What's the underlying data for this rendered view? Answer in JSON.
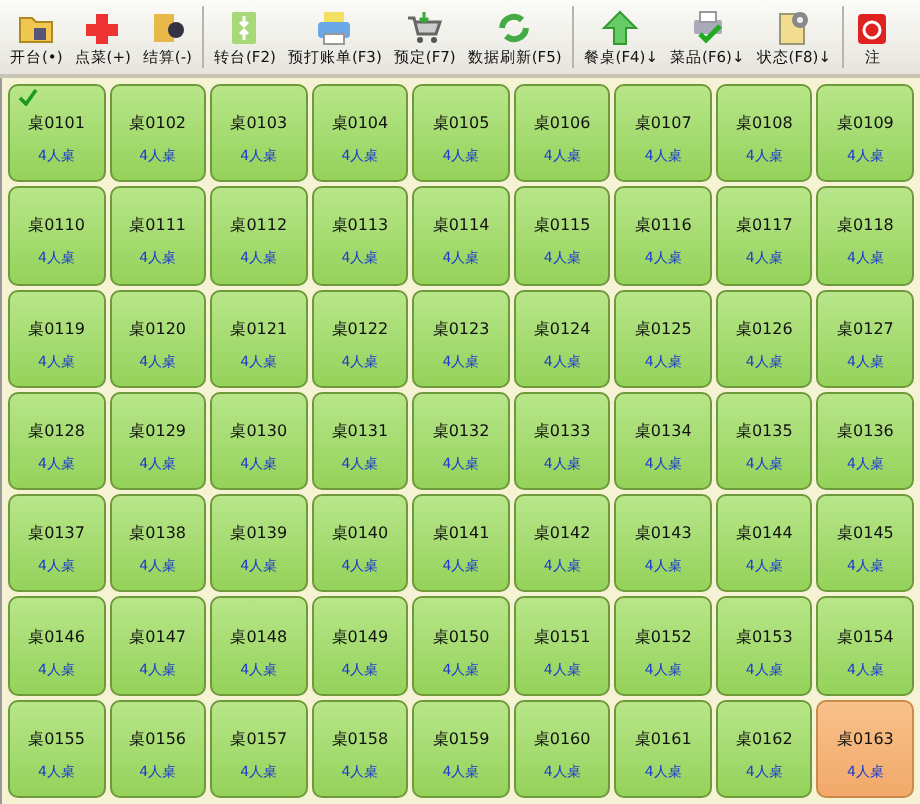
{
  "toolbar": [
    {
      "label": "开台(•)"
    },
    {
      "label": "点菜(+)"
    },
    {
      "label": "结算(-)"
    },
    {
      "label": "转台(F2)"
    },
    {
      "label": "预打账单(F3)"
    },
    {
      "label": "预定(F7)"
    },
    {
      "label": "数据刷新(F5)"
    },
    {
      "label": "餐桌(F4)↓"
    },
    {
      "label": "菜品(F6)↓"
    },
    {
      "label": "状态(F8)↓"
    },
    {
      "label": "注"
    }
  ],
  "tables": [
    {
      "name": "桌0101",
      "capacity": "4人桌",
      "checked": true,
      "highlighted": false
    },
    {
      "name": "桌0102",
      "capacity": "4人桌",
      "checked": false,
      "highlighted": false
    },
    {
      "name": "桌0103",
      "capacity": "4人桌",
      "checked": false,
      "highlighted": false
    },
    {
      "name": "桌0104",
      "capacity": "4人桌",
      "checked": false,
      "highlighted": false
    },
    {
      "name": "桌0105",
      "capacity": "4人桌",
      "checked": false,
      "highlighted": false
    },
    {
      "name": "桌0106",
      "capacity": "4人桌",
      "checked": false,
      "highlighted": false
    },
    {
      "name": "桌0107",
      "capacity": "4人桌",
      "checked": false,
      "highlighted": false
    },
    {
      "name": "桌0108",
      "capacity": "4人桌",
      "checked": false,
      "highlighted": false
    },
    {
      "name": "桌0109",
      "capacity": "4人桌",
      "checked": false,
      "highlighted": false
    },
    {
      "name": "桌0110",
      "capacity": "4人桌",
      "checked": false,
      "highlighted": false
    },
    {
      "name": "桌0111",
      "capacity": "4人桌",
      "checked": false,
      "highlighted": false
    },
    {
      "name": "桌0112",
      "capacity": "4人桌",
      "checked": false,
      "highlighted": false
    },
    {
      "name": "桌0113",
      "capacity": "4人桌",
      "checked": false,
      "highlighted": false
    },
    {
      "name": "桌0114",
      "capacity": "4人桌",
      "checked": false,
      "highlighted": false
    },
    {
      "name": "桌0115",
      "capacity": "4人桌",
      "checked": false,
      "highlighted": false
    },
    {
      "name": "桌0116",
      "capacity": "4人桌",
      "checked": false,
      "highlighted": false
    },
    {
      "name": "桌0117",
      "capacity": "4人桌",
      "checked": false,
      "highlighted": false
    },
    {
      "name": "桌0118",
      "capacity": "4人桌",
      "checked": false,
      "highlighted": false
    },
    {
      "name": "桌0119",
      "capacity": "4人桌",
      "checked": false,
      "highlighted": false
    },
    {
      "name": "桌0120",
      "capacity": "4人桌",
      "checked": false,
      "highlighted": false
    },
    {
      "name": "桌0121",
      "capacity": "4人桌",
      "checked": false,
      "highlighted": false
    },
    {
      "name": "桌0122",
      "capacity": "4人桌",
      "checked": false,
      "highlighted": false
    },
    {
      "name": "桌0123",
      "capacity": "4人桌",
      "checked": false,
      "highlighted": false
    },
    {
      "name": "桌0124",
      "capacity": "4人桌",
      "checked": false,
      "highlighted": false
    },
    {
      "name": "桌0125",
      "capacity": "4人桌",
      "checked": false,
      "highlighted": false
    },
    {
      "name": "桌0126",
      "capacity": "4人桌",
      "checked": false,
      "highlighted": false
    },
    {
      "name": "桌0127",
      "capacity": "4人桌",
      "checked": false,
      "highlighted": false
    },
    {
      "name": "桌0128",
      "capacity": "4人桌",
      "checked": false,
      "highlighted": false
    },
    {
      "name": "桌0129",
      "capacity": "4人桌",
      "checked": false,
      "highlighted": false
    },
    {
      "name": "桌0130",
      "capacity": "4人桌",
      "checked": false,
      "highlighted": false
    },
    {
      "name": "桌0131",
      "capacity": "4人桌",
      "checked": false,
      "highlighted": false
    },
    {
      "name": "桌0132",
      "capacity": "4人桌",
      "checked": false,
      "highlighted": false
    },
    {
      "name": "桌0133",
      "capacity": "4人桌",
      "checked": false,
      "highlighted": false
    },
    {
      "name": "桌0134",
      "capacity": "4人桌",
      "checked": false,
      "highlighted": false
    },
    {
      "name": "桌0135",
      "capacity": "4人桌",
      "checked": false,
      "highlighted": false
    },
    {
      "name": "桌0136",
      "capacity": "4人桌",
      "checked": false,
      "highlighted": false
    },
    {
      "name": "桌0137",
      "capacity": "4人桌",
      "checked": false,
      "highlighted": false
    },
    {
      "name": "桌0138",
      "capacity": "4人桌",
      "checked": false,
      "highlighted": false
    },
    {
      "name": "桌0139",
      "capacity": "4人桌",
      "checked": false,
      "highlighted": false
    },
    {
      "name": "桌0140",
      "capacity": "4人桌",
      "checked": false,
      "highlighted": false
    },
    {
      "name": "桌0141",
      "capacity": "4人桌",
      "checked": false,
      "highlighted": false
    },
    {
      "name": "桌0142",
      "capacity": "4人桌",
      "checked": false,
      "highlighted": false
    },
    {
      "name": "桌0143",
      "capacity": "4人桌",
      "checked": false,
      "highlighted": false
    },
    {
      "name": "桌0144",
      "capacity": "4人桌",
      "checked": false,
      "highlighted": false
    },
    {
      "name": "桌0145",
      "capacity": "4人桌",
      "checked": false,
      "highlighted": false
    },
    {
      "name": "桌0146",
      "capacity": "4人桌",
      "checked": false,
      "highlighted": false
    },
    {
      "name": "桌0147",
      "capacity": "4人桌",
      "checked": false,
      "highlighted": false
    },
    {
      "name": "桌0148",
      "capacity": "4人桌",
      "checked": false,
      "highlighted": false
    },
    {
      "name": "桌0149",
      "capacity": "4人桌",
      "checked": false,
      "highlighted": false
    },
    {
      "name": "桌0150",
      "capacity": "4人桌",
      "checked": false,
      "highlighted": false
    },
    {
      "name": "桌0151",
      "capacity": "4人桌",
      "checked": false,
      "highlighted": false
    },
    {
      "name": "桌0152",
      "capacity": "4人桌",
      "checked": false,
      "highlighted": false
    },
    {
      "name": "桌0153",
      "capacity": "4人桌",
      "checked": false,
      "highlighted": false
    },
    {
      "name": "桌0154",
      "capacity": "4人桌",
      "checked": false,
      "highlighted": false
    },
    {
      "name": "桌0155",
      "capacity": "4人桌",
      "checked": false,
      "highlighted": false
    },
    {
      "name": "桌0156",
      "capacity": "4人桌",
      "checked": false,
      "highlighted": false
    },
    {
      "name": "桌0157",
      "capacity": "4人桌",
      "checked": false,
      "highlighted": false
    },
    {
      "name": "桌0158",
      "capacity": "4人桌",
      "checked": false,
      "highlighted": false
    },
    {
      "name": "桌0159",
      "capacity": "4人桌",
      "checked": false,
      "highlighted": false
    },
    {
      "name": "桌0160",
      "capacity": "4人桌",
      "checked": false,
      "highlighted": false
    },
    {
      "name": "桌0161",
      "capacity": "4人桌",
      "checked": false,
      "highlighted": false
    },
    {
      "name": "桌0162",
      "capacity": "4人桌",
      "checked": false,
      "highlighted": false
    },
    {
      "name": "桌0163",
      "capacity": "4人桌",
      "checked": false,
      "highlighted": true
    }
  ]
}
